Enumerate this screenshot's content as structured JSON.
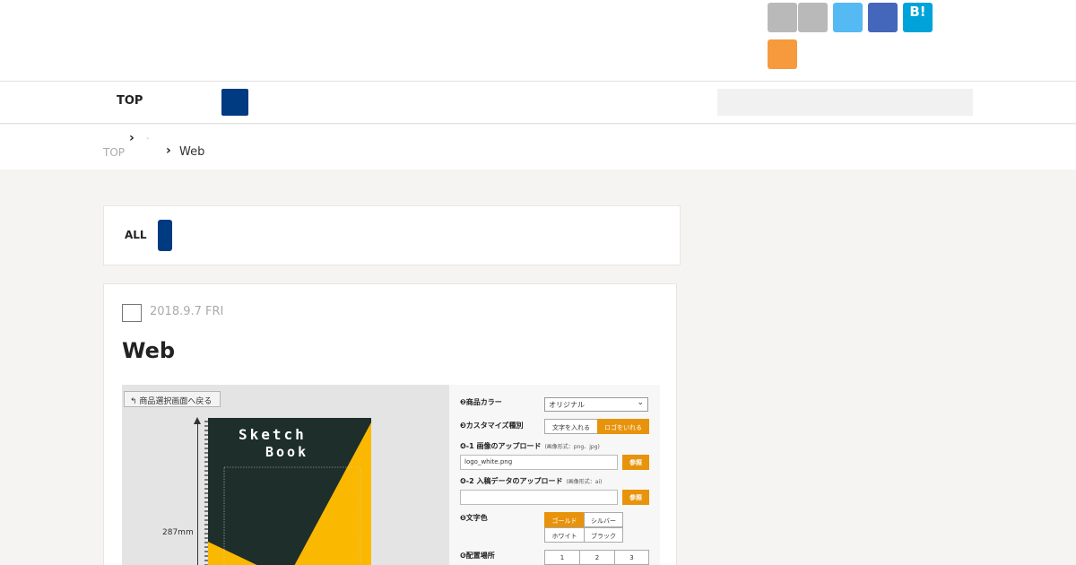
{
  "header": {
    "share_buttons": [
      {
        "name": "share-gray-1",
        "color": "#b9b9b9",
        "label": ""
      },
      {
        "name": "share-gray-2",
        "color": "#b9b9b9",
        "label": ""
      },
      {
        "name": "twitter",
        "color": "#55b9f3",
        "label": ""
      },
      {
        "name": "facebook",
        "color": "#4466bb",
        "label": ""
      },
      {
        "name": "hatena-bookmark",
        "color": "#00a3d9",
        "label": "B!"
      },
      {
        "name": "feedly",
        "color": "#f79a3e",
        "label": ""
      }
    ]
  },
  "nav": {
    "top_label": "TOP",
    "accent_color": "#003a80",
    "search_placeholder": ""
  },
  "breadcrumb": {
    "top_label": "TOP",
    "separator_text": "-",
    "current_label": "Web"
  },
  "categories": {
    "all_label": "ALL"
  },
  "article": {
    "date": "2018.9.7 FRI",
    "title": "Web",
    "image": {
      "back_button": "商品選択画面へ戻る",
      "dimension_label": "287mm",
      "book_title_line1": "Sketch",
      "book_title_line2": "Book",
      "options": {
        "color_label": "❷商品カラー",
        "color_value": "オリジナル",
        "customize_label": "❸カスタマイズ種別",
        "customize_options": [
          "文字を入れる",
          "ロゴをいれる"
        ],
        "customize_selected": 1,
        "upload_label": "❹-1 画像のアップロード",
        "upload_note": "(画像形式：png、jpg)",
        "upload_value": "logo_white.png",
        "upload_button": "参照",
        "manuscript_label": "❹-2 入稿データのアップロード",
        "manuscript_note": "(画像形式：ai)",
        "manuscript_value": "",
        "manuscript_button": "参照",
        "text_color_label": "❺文字色",
        "text_colors": [
          "ゴールド",
          "シルバー",
          "ホワイト",
          "ブラック"
        ],
        "text_color_selected": 0,
        "position_label": "❻配置場所",
        "positions": [
          "1",
          "2",
          "3"
        ]
      }
    }
  }
}
